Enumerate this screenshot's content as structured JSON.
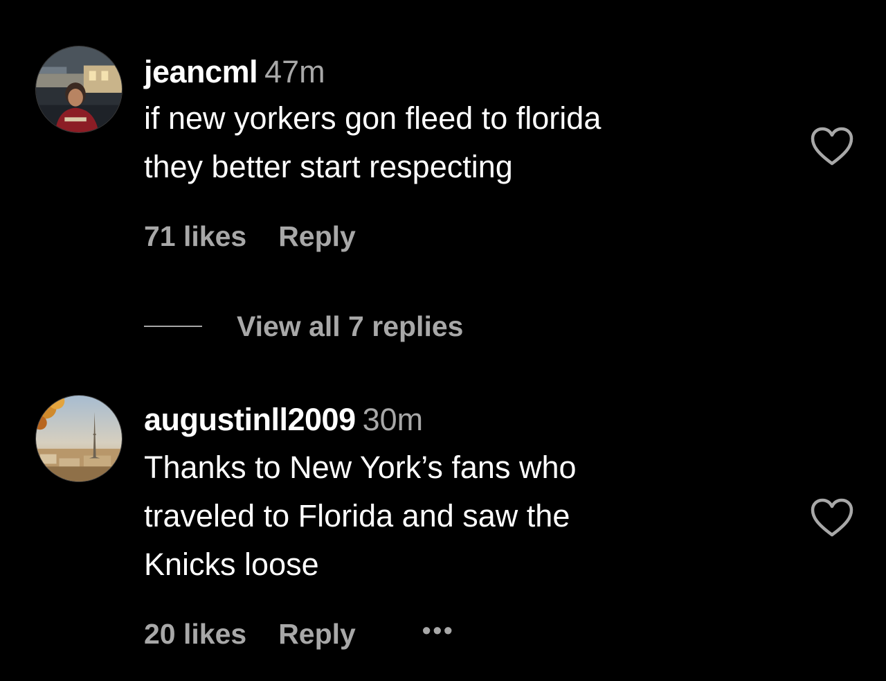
{
  "comments": [
    {
      "username": "jeancml",
      "time": "47m",
      "text_lines": [
        "if new yorkers gon fleed to florida",
        "they better start respecting"
      ],
      "likes": "71 likes",
      "reply_label": "Reply",
      "view_replies_label": "View all 7 replies",
      "avatar_icon": "profile-photo",
      "like_icon": "heart-outline-icon"
    },
    {
      "username": "augustinll2009",
      "time": "30m",
      "text_lines": [
        "Thanks to New York’s fans who",
        "traveled to Florida and saw the",
        "Knicks loose"
      ],
      "likes": "20 likes",
      "reply_label": "Reply",
      "more_label": "•••",
      "avatar_icon": "profile-photo",
      "like_icon": "heart-outline-icon"
    }
  ],
  "colors": {
    "background": "#000000",
    "primary_text": "#ffffff",
    "secondary_text": "#a8a8a8"
  }
}
